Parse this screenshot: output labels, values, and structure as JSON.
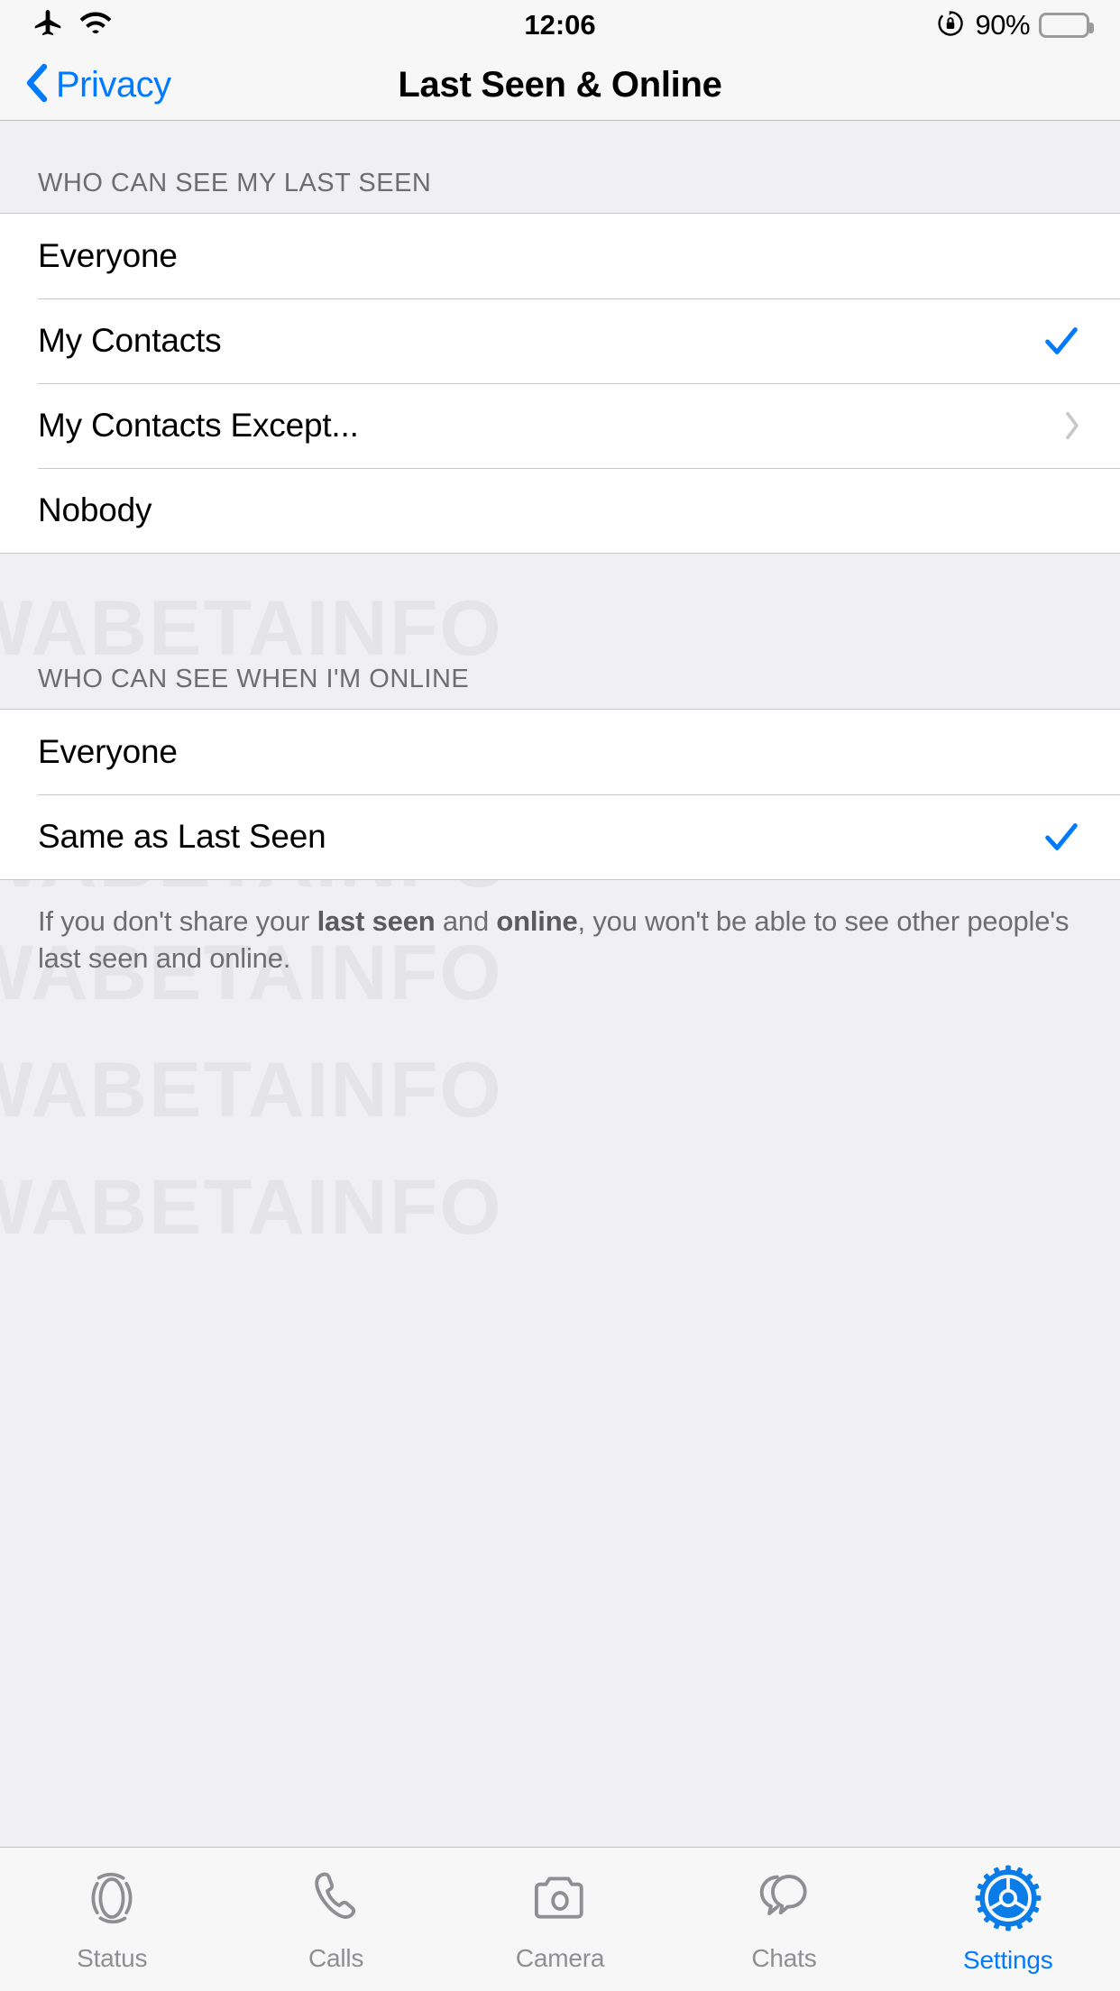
{
  "watermark": {
    "text": "WABETAINFO"
  },
  "colors": {
    "accent": "#007AFF",
    "background": "#EFEFF4",
    "row_bg": "#FFFFFF",
    "separator": "#C8C7CC",
    "section_header_text": "#6D6D72",
    "battery_fill": "#FFCC00",
    "tab_inactive": "#8E8E93"
  },
  "status_bar": {
    "airplane_icon": "airplane-icon",
    "wifi_icon": "wifi-icon",
    "time": "12:06",
    "rotation_lock_icon": "rotation-lock-icon",
    "battery_percent": "90%",
    "battery_level": 90,
    "battery_icon": "battery-icon"
  },
  "nav_bar": {
    "back_icon": "chevron-left-icon",
    "back_label": "Privacy",
    "title": "Last Seen & Online"
  },
  "sections": [
    {
      "header": "WHO CAN SEE MY LAST SEEN",
      "rows": [
        {
          "label": "Everyone",
          "accessory": "none"
        },
        {
          "label": "My Contacts",
          "accessory": "check"
        },
        {
          "label": "My Contacts Except...",
          "accessory": "chevron"
        },
        {
          "label": "Nobody",
          "accessory": "none"
        }
      ]
    },
    {
      "header": "WHO CAN SEE WHEN I'M ONLINE",
      "rows": [
        {
          "label": "Everyone",
          "accessory": "none"
        },
        {
          "label": "Same as Last Seen",
          "accessory": "check"
        }
      ]
    }
  ],
  "footer_note": {
    "part1": "If you don't share your ",
    "bold1": "last seen",
    "part2": " and ",
    "bold2": "online",
    "part3": ", you won't be able to see other people's last seen and online."
  },
  "tab_bar": {
    "tabs": [
      {
        "label": "Status",
        "icon": "status-rings-icon",
        "active": false
      },
      {
        "label": "Calls",
        "icon": "phone-icon",
        "active": false
      },
      {
        "label": "Camera",
        "icon": "camera-icon",
        "active": false
      },
      {
        "label": "Chats",
        "icon": "chat-bubbles-icon",
        "active": false
      },
      {
        "label": "Settings",
        "icon": "gear-icon",
        "active": true
      }
    ]
  }
}
